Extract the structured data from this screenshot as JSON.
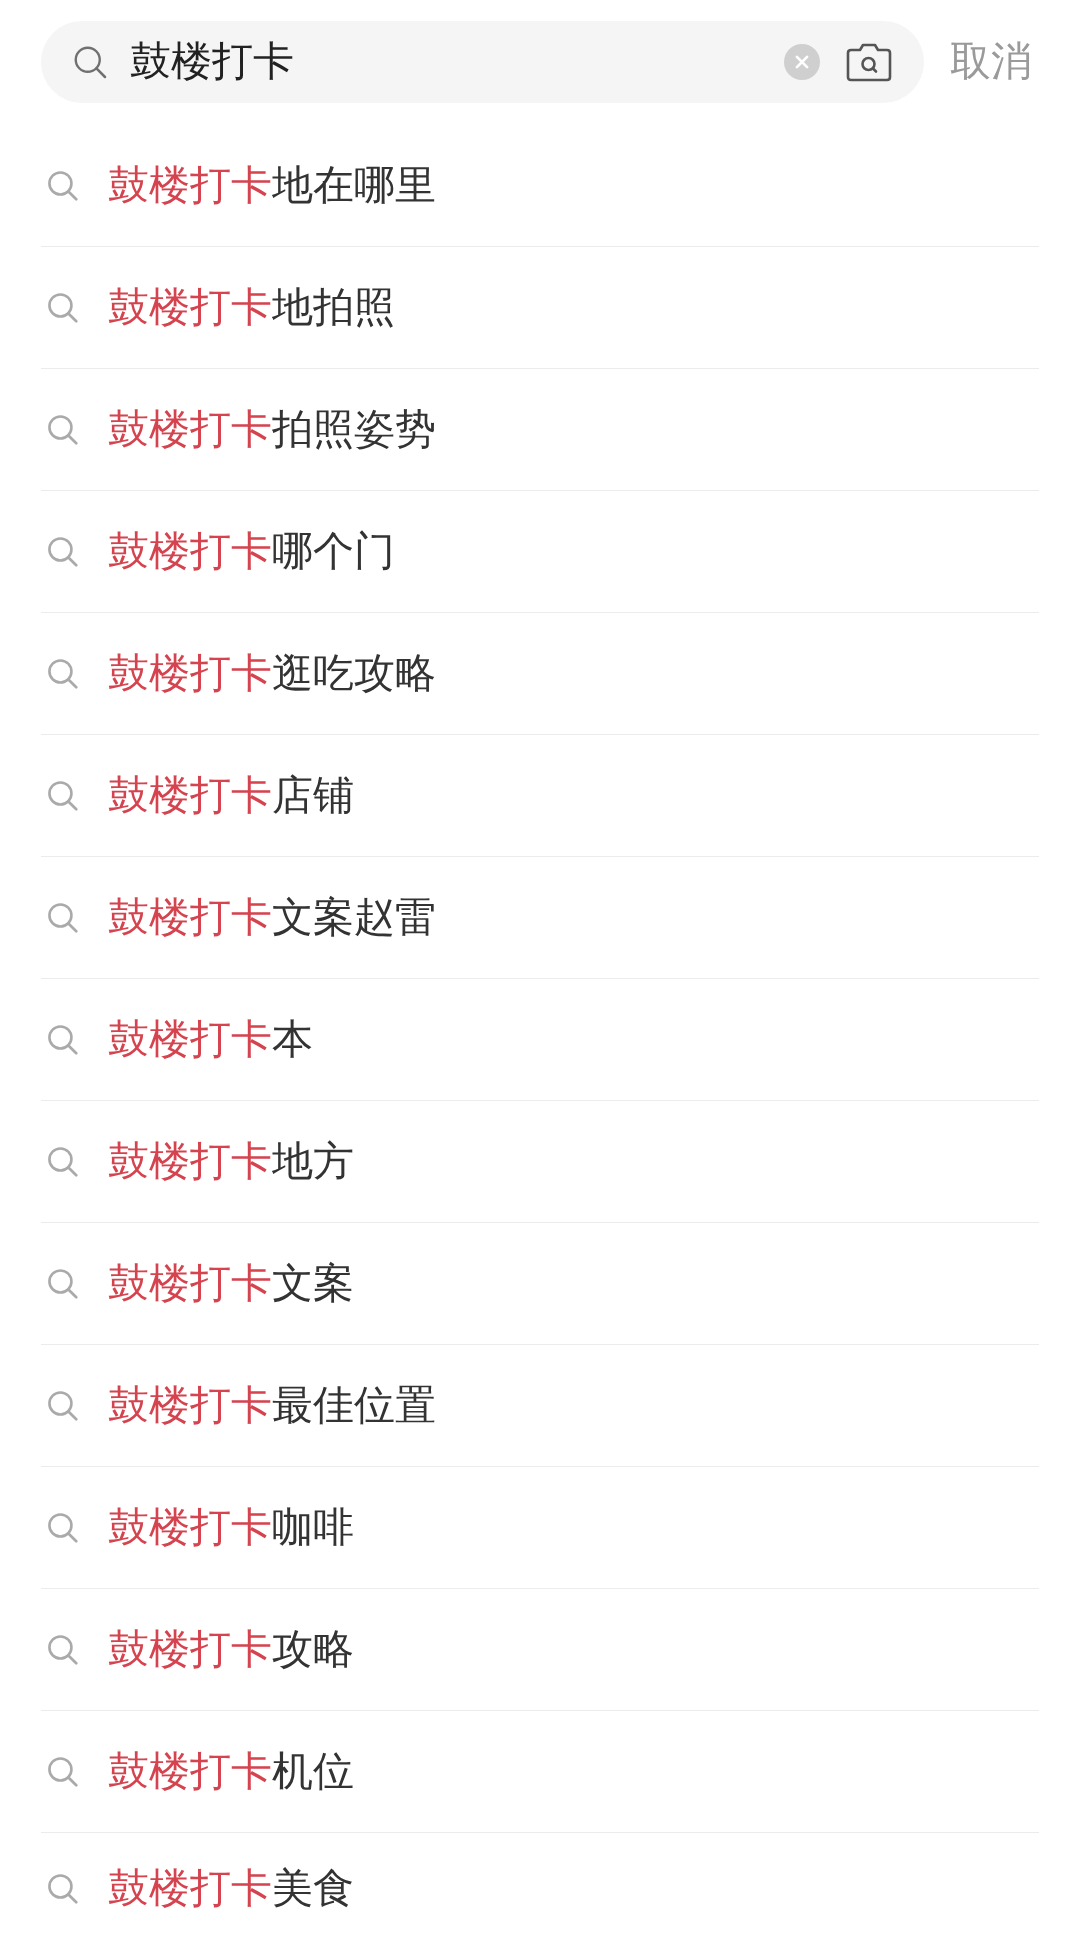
{
  "search": {
    "value": "鼓楼打卡",
    "cancel": "取消"
  },
  "suggestions": [
    {
      "match": "鼓楼打卡",
      "rest": "地在哪里"
    },
    {
      "match": "鼓楼打卡",
      "rest": "地拍照"
    },
    {
      "match": "鼓楼打卡",
      "rest": "拍照姿势"
    },
    {
      "match": "鼓楼打卡",
      "rest": "哪个门"
    },
    {
      "match": "鼓楼打卡",
      "rest": "逛吃攻略"
    },
    {
      "match": "鼓楼打卡",
      "rest": "店铺"
    },
    {
      "match": "鼓楼打卡",
      "rest": "文案赵雷"
    },
    {
      "match": "鼓楼打卡",
      "rest": "本"
    },
    {
      "match": "鼓楼打卡",
      "rest": "地方"
    },
    {
      "match": "鼓楼打卡",
      "rest": "文案"
    },
    {
      "match": "鼓楼打卡",
      "rest": "最佳位置"
    },
    {
      "match": "鼓楼打卡",
      "rest": "咖啡"
    },
    {
      "match": "鼓楼打卡",
      "rest": "攻略"
    },
    {
      "match": "鼓楼打卡",
      "rest": "机位"
    },
    {
      "match": "鼓楼打卡",
      "rest": "美食"
    }
  ]
}
